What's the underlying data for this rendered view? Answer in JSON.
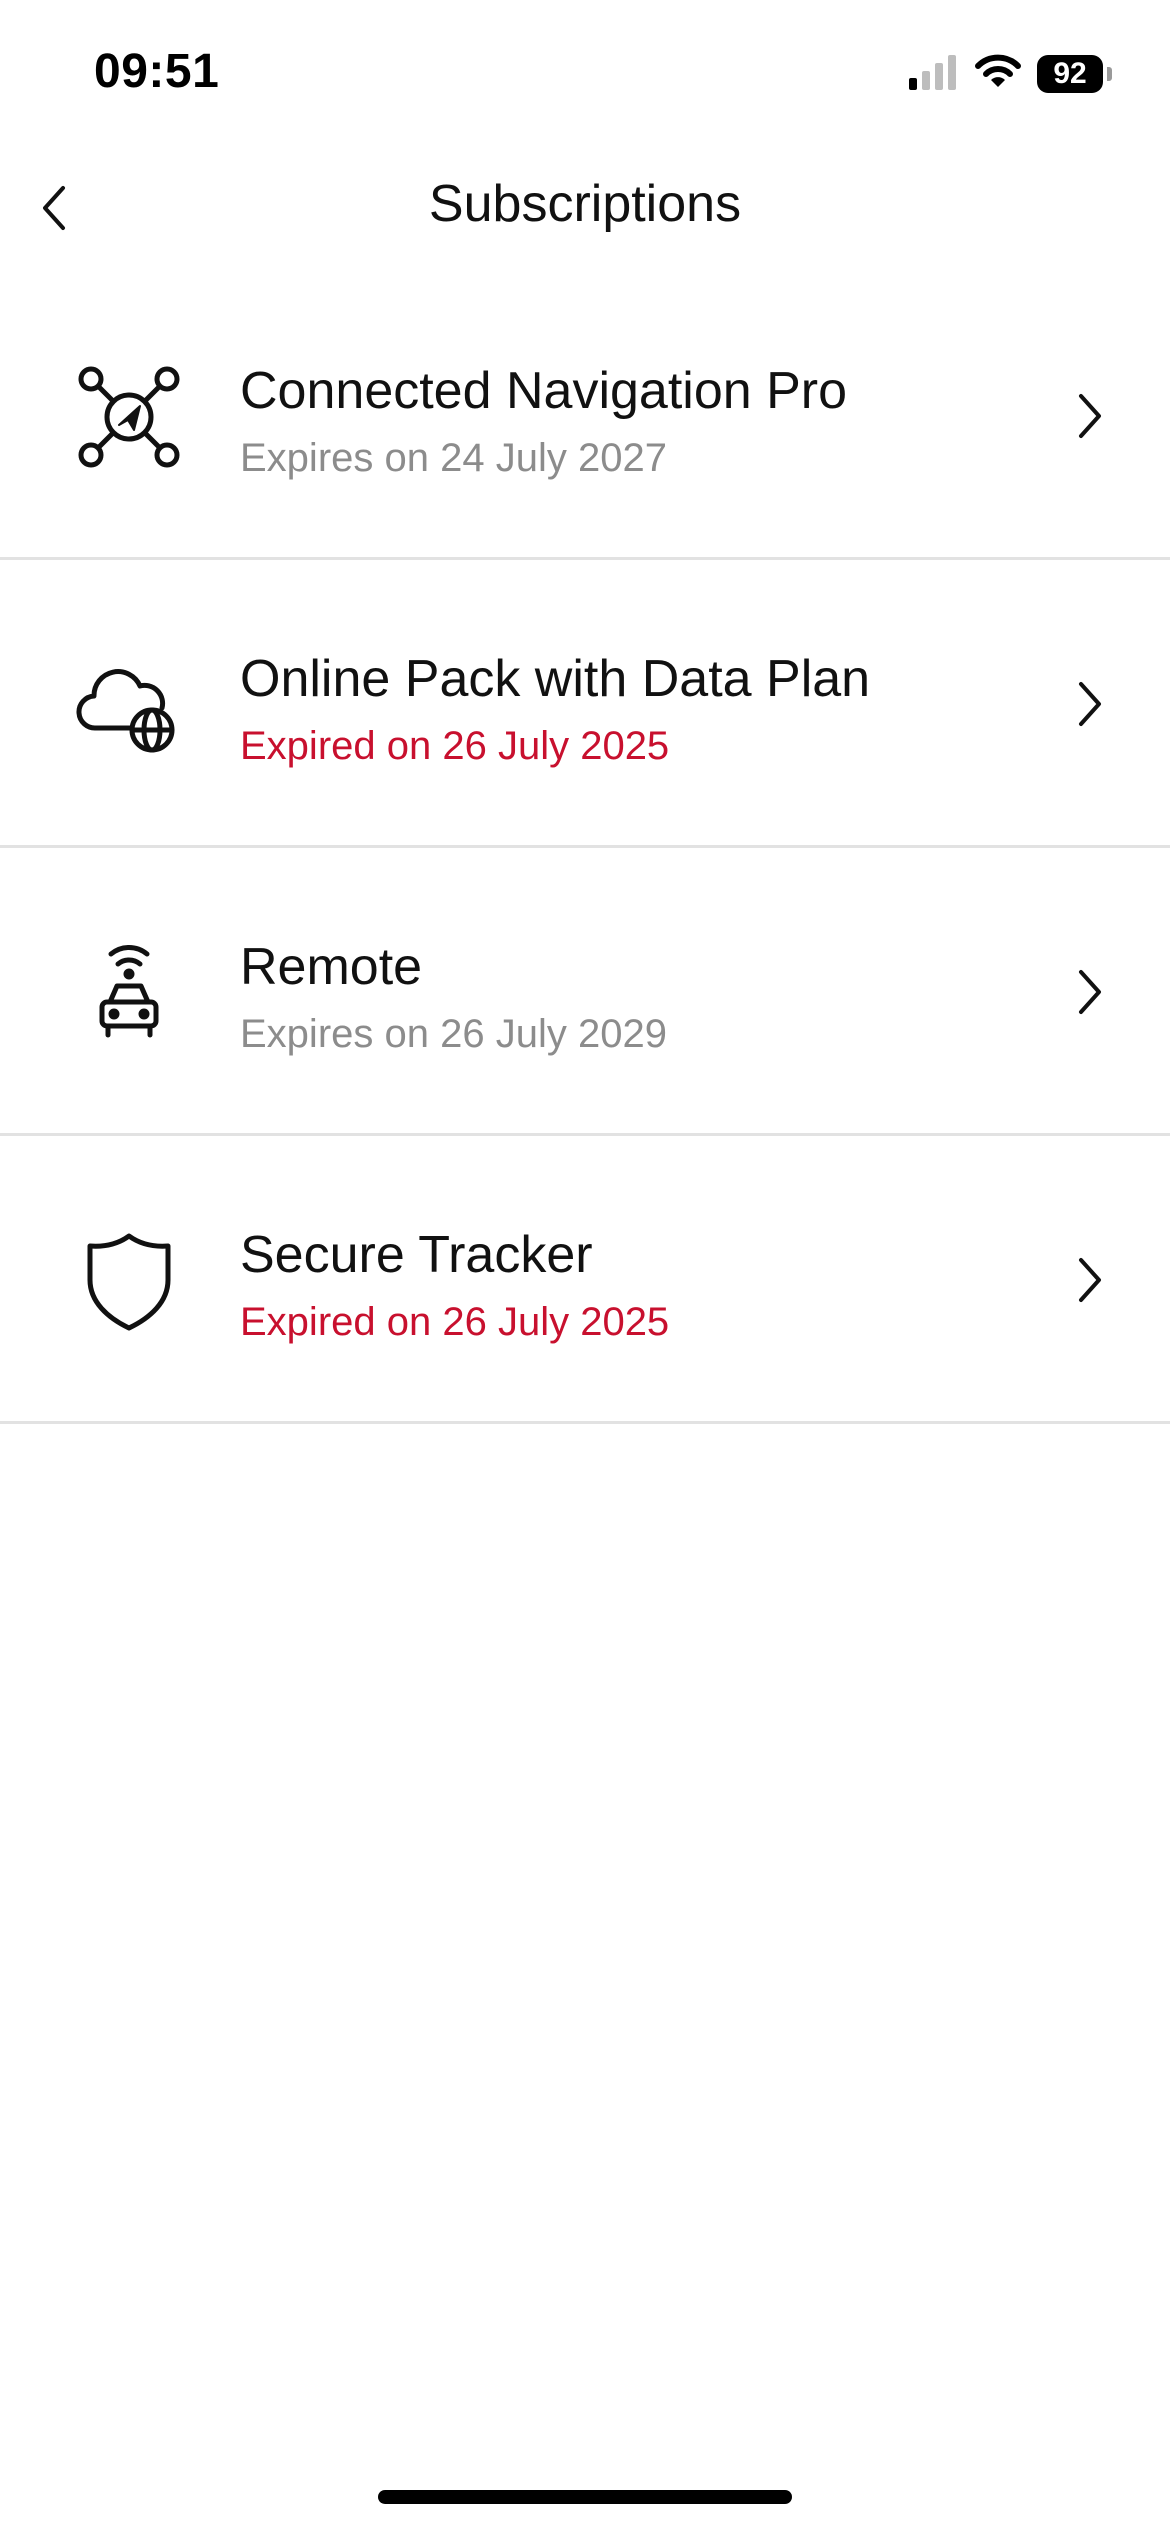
{
  "status_bar": {
    "time": "09:51",
    "battery": "92"
  },
  "header": {
    "title": "Subscriptions"
  },
  "subscriptions": [
    {
      "icon": "network-nav-icon",
      "title": "Connected Navigation Pro",
      "status_text": "Expires on 24 July 2027",
      "state": "active"
    },
    {
      "icon": "cloud-globe-icon",
      "title": "Online Pack with Data Plan",
      "status_text": "Expired on 26 July 2025",
      "state": "expired"
    },
    {
      "icon": "remote-car-icon",
      "title": "Remote",
      "status_text": "Expires on 26 July 2029",
      "state": "active"
    },
    {
      "icon": "shield-icon",
      "title": "Secure Tracker",
      "status_text": "Expired on 26 July 2025",
      "state": "expired"
    }
  ],
  "colors": {
    "expired": "#c8102e",
    "active_sub": "#8c8c8c",
    "divider": "#e2e2e2"
  }
}
